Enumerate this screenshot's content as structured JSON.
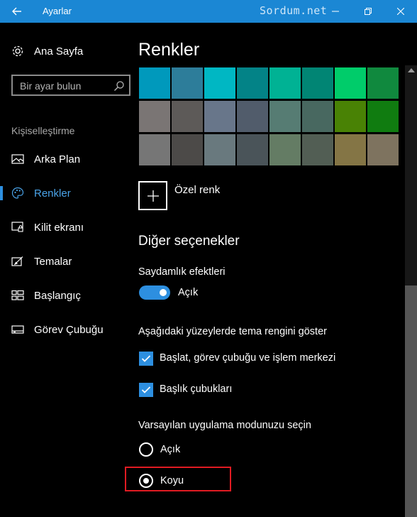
{
  "window": {
    "title": "Ayarlar",
    "watermark": "Sordum.net",
    "accent": "#1b87d4"
  },
  "sidebar": {
    "home_label": "Ana Sayfa",
    "search_placeholder": "Bir ayar bulun",
    "section_label": "Kişiselleştirme",
    "items": [
      {
        "label": "Arka Plan",
        "icon": "picture-icon",
        "active": false
      },
      {
        "label": "Renkler",
        "icon": "palette-icon",
        "active": true
      },
      {
        "label": "Kilit ekranı",
        "icon": "lock-screen-icon",
        "active": false
      },
      {
        "label": "Temalar",
        "icon": "themes-icon",
        "active": false
      },
      {
        "label": "Başlangıç",
        "icon": "start-icon",
        "active": false
      },
      {
        "label": "Görev Çubuğu",
        "icon": "taskbar-icon",
        "active": false
      }
    ]
  },
  "main": {
    "title": "Renkler",
    "color_grid": [
      [
        "#0099bc",
        "#2d7d9a",
        "#00b7c3",
        "#038387",
        "#00b294",
        "#018574",
        "#00cc6a",
        "#10893e"
      ],
      [
        "#7a7574",
        "#5d5a58",
        "#68768a",
        "#515c6b",
        "#567c73",
        "#486860",
        "#498205",
        "#107c10"
      ],
      [
        "#767676",
        "#4c4a48",
        "#69797e",
        "#4a5459",
        "#647c64",
        "#525e54",
        "#847545",
        "#7e735f"
      ]
    ],
    "custom_color_label": "Özel renk",
    "other_options_heading": "Diğer seçenekler",
    "transparency_label": "Saydamlık efektleri",
    "transparency_state": "Açık",
    "surfaces_label": "Aşağıdaki yüzeylerde tema rengini göster",
    "checkbox_start_label": "Başlat, görev çubuğu ve işlem merkezi",
    "checkbox_titlebar_label": "Başlık çubukları",
    "app_mode_label": "Varsayılan uygulama modunuzu seçin",
    "mode_light_label": "Açık",
    "mode_dark_label": "Koyu",
    "selected_mode": "Koyu"
  }
}
